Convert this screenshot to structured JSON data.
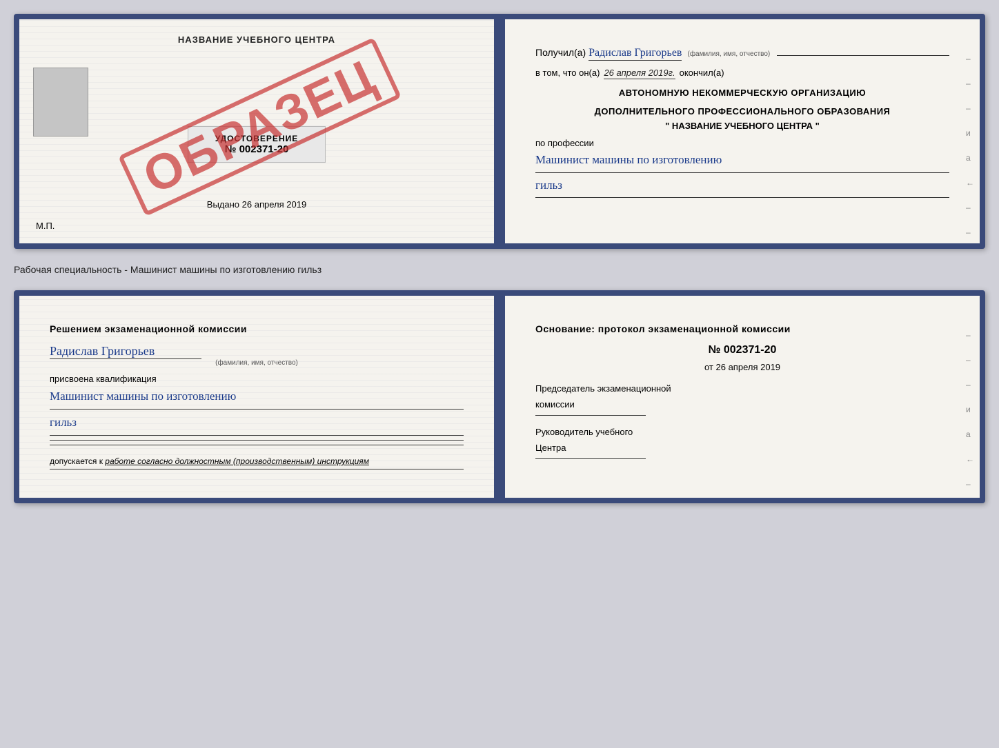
{
  "top_card": {
    "left": {
      "title": "НАЗВАНИЕ УЧЕБНОГО ЦЕНТРА",
      "stamp": "ОБРАЗЕЦ",
      "udostoverenie": {
        "label": "УДОСТОВЕРЕНИЕ",
        "number": "№ 002371-20"
      },
      "vydano": "Выдано 26 апреля 2019",
      "mp": "М.П."
    },
    "right": {
      "poluchil_prefix": "Получил(а)",
      "poluchil_name": "Радислав Григорьев",
      "poluchil_sub": "(фамилия, имя, отчество)",
      "vtom_prefix": "в том, что он(а)",
      "vtom_date": "26 апреля 2019г.",
      "okoncil": "окончил(а)",
      "org_line1": "АВТОНОМНУЮ НЕКОММЕРЧЕСКУЮ ОРГАНИЗАЦИЮ",
      "org_line2": "ДОПОЛНИТЕЛЬНОГО ПРОФЕССИОНАЛЬНОГО ОБРАЗОВАНИЯ",
      "org_name": "\" НАЗВАНИЕ УЧЕБНОГО ЦЕНТРА \"",
      "po_professii": "по профессии",
      "profession_line1": "Машинист машины по изготовлению",
      "profession_line2": "гильз",
      "dashes": [
        "-",
        "-",
        "-",
        "и",
        "а",
        "←",
        "-",
        "-",
        "-"
      ]
    }
  },
  "between_label": "Рабочая специальность - Машинист машины по изготовлению гильз",
  "bottom_card": {
    "left": {
      "resheniem_title": "Решением экзаменационной комиссии",
      "name": "Радислав Григорьев",
      "name_sub": "(фамилия, имя, отчество)",
      "prisvoena": "присвоена квалификация",
      "qualification_line1": "Машинист машины по изготовлению",
      "qualification_line2": "гильз",
      "dopuskaetsya": "допускается к",
      "dopuskaetsya_italic": "работе согласно должностным (производственным) инструкциям"
    },
    "right": {
      "osnovanie_title": "Основание: протокол экзаменационной комиссии",
      "protocol_number": "№ 002371-20",
      "protocol_date_prefix": "от",
      "protocol_date": "26 апреля 2019",
      "predsedatel_line1": "Председатель экзаменационной",
      "predsedatel_line2": "комиссии",
      "rukovoditel_line1": "Руководитель учебного",
      "rukovoditel_line2": "Центра",
      "dashes": [
        "-",
        "-",
        "-",
        "и",
        "а",
        "←",
        "-",
        "-",
        "-"
      ]
    }
  }
}
